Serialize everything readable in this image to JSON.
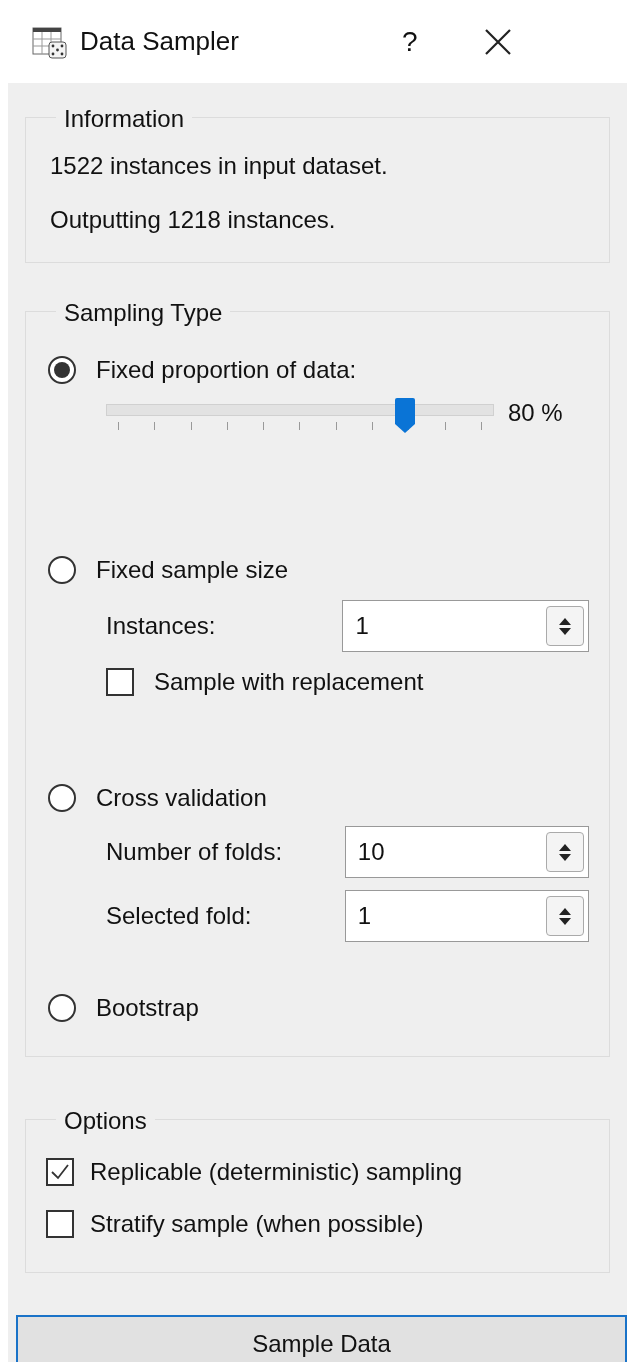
{
  "window": {
    "title": "Data Sampler",
    "help": "?"
  },
  "information": {
    "title": "Information",
    "lines": [
      "1522 instances in input dataset.",
      "Outputting 1218 instances."
    ]
  },
  "sampling_type": {
    "title": "Sampling Type",
    "options": [
      {
        "kind": "slider",
        "label": "Fixed proportion of data:",
        "selected": true,
        "level": 0.8,
        "reading": "80 %"
      },
      {
        "kind": "size",
        "label": "Fixed sample size",
        "selected": false,
        "instances_label": "Instances:",
        "instances": "1",
        "replacement_label": "Sample with replacement",
        "replacement": false
      },
      {
        "kind": "folds",
        "label": "Cross validation",
        "selected": false,
        "folds_label": "Number of folds:",
        "folds": "10",
        "fold_label": "Selected fold:",
        "fold": "1"
      },
      {
        "kind": "plain",
        "label": "Bootstrap",
        "selected": false
      }
    ]
  },
  "options": {
    "title": "Options",
    "items": [
      {
        "label": "Replicable (deterministic) sampling",
        "checked": true
      },
      {
        "label": "Stratify sample (when possible)",
        "checked": false
      }
    ]
  },
  "button": "Sample Data"
}
